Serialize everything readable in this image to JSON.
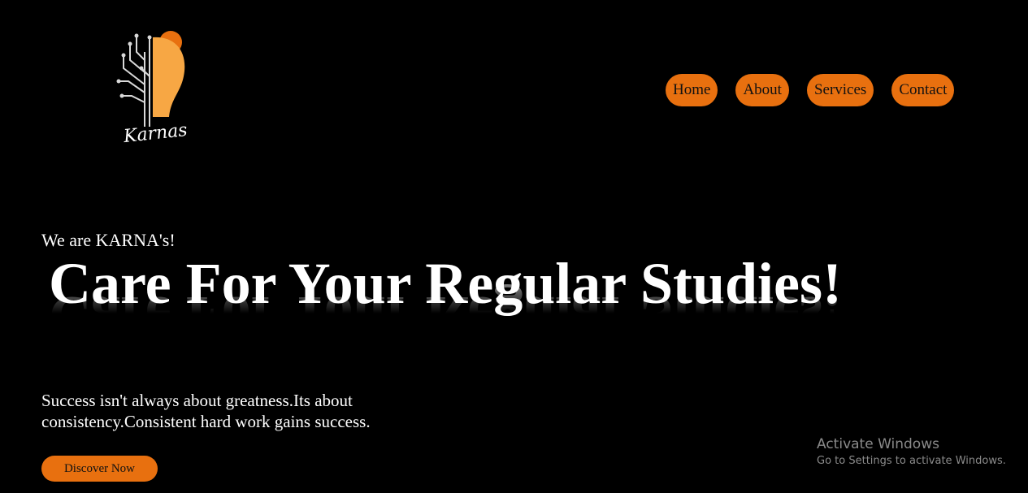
{
  "logo": {
    "text": "Karnas",
    "accent_color": "#e8700f",
    "bulb_color": "#f7a744"
  },
  "nav": {
    "items": [
      {
        "label": "Home"
      },
      {
        "label": "About"
      },
      {
        "label": "Services"
      },
      {
        "label": "Contact"
      }
    ]
  },
  "hero": {
    "tagline": "We are KARNA's!",
    "headline": "Care For Your Regular Studies!",
    "description": "Success isn't always about greatness.Its about consistency.Consistent hard work gains success.",
    "cta_label": "Discover Now"
  },
  "watermark": {
    "title": "Activate Windows",
    "subtitle": "Go to Settings to activate Windows."
  },
  "colors": {
    "background": "#000000",
    "accent": "#e8700f",
    "text": "#ffffff"
  }
}
